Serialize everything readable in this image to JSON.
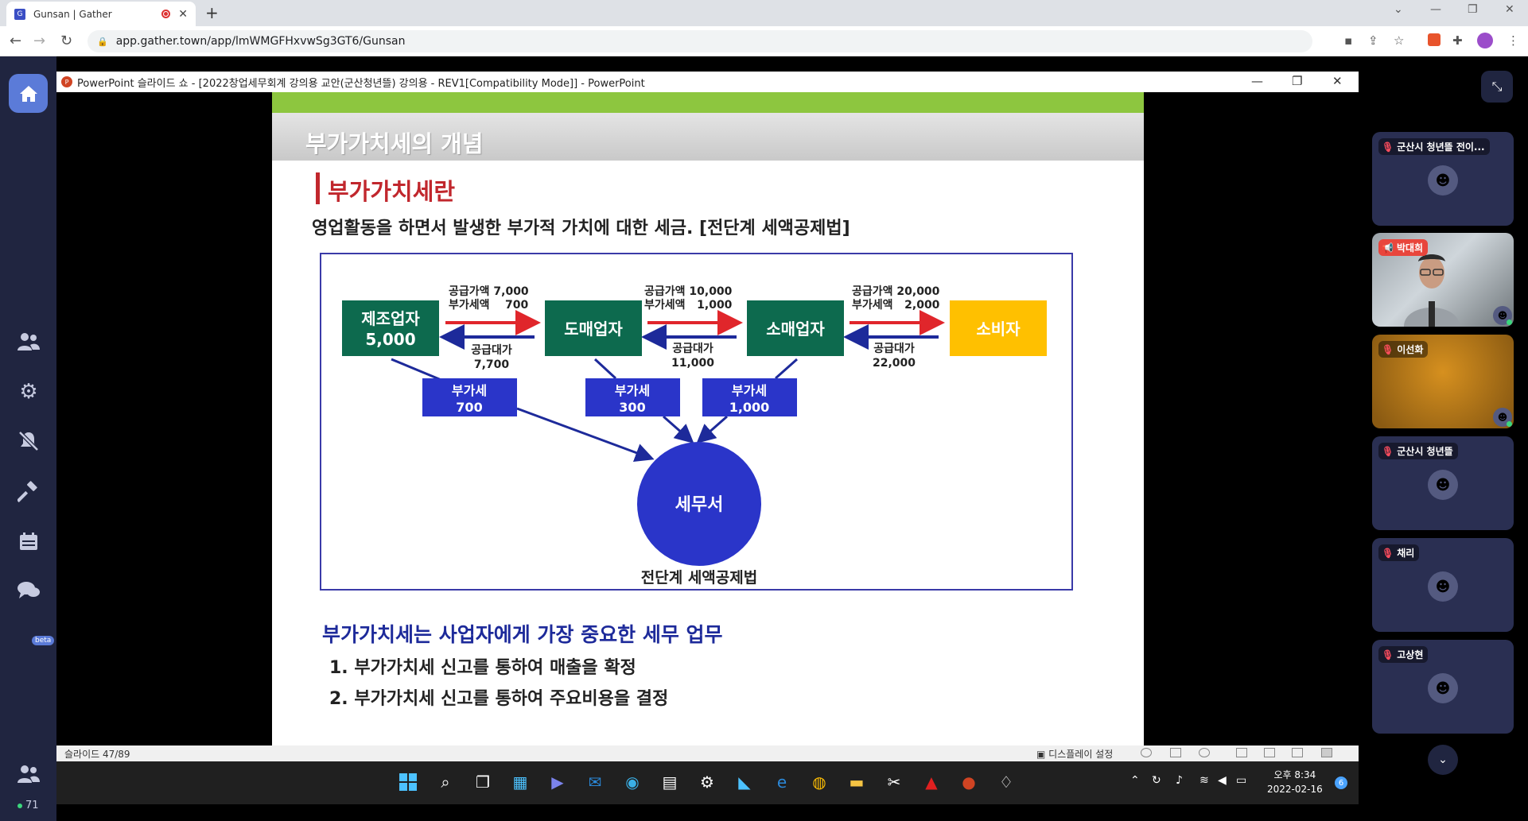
{
  "browser": {
    "tab_title": "Gunsan | Gather",
    "tab_favicon_letter": "G",
    "url": "app.gather.town/app/lmWMGFHxvwSg3GT6/Gunsan"
  },
  "gather": {
    "online_count": "71",
    "beta_label": "beta",
    "participants": [
      {
        "name": "군산시 청년뜰 전이...",
        "muted": true,
        "video": false
      },
      {
        "name": "박대희",
        "muted": false,
        "video": true,
        "presenting": true
      },
      {
        "name": "이선화",
        "muted": true,
        "video": true
      },
      {
        "name": "군산시 청년뜰",
        "muted": true,
        "video": false
      },
      {
        "name": "채리",
        "muted": true,
        "video": false
      },
      {
        "name": "고상현",
        "muted": true,
        "video": false
      }
    ]
  },
  "powerpoint": {
    "window_title": "PowerPoint 슬라이드 쇼 - [2022창업세무회계 강의용 교안(군산청년뜰) 강의용 - REV1[Compatibility Mode]] - PowerPoint",
    "slide_counter": "슬라이드 47/89",
    "display_settings": "디스플레이 설정"
  },
  "slide": {
    "header": "부가가치세의 개념",
    "subtitle": "부가가치세란",
    "description": "영업활동을 하면서 발생한 부가적 가치에 대한 세금. [전단계 세액공제법]",
    "diagram": {
      "entities": [
        {
          "label_line1": "제조업자",
          "label_line2": "5,000",
          "color": "#0d6a4e"
        },
        {
          "label_line1": "도매업자",
          "label_line2": "",
          "color": "#0d6a4e"
        },
        {
          "label_line1": "소매업자",
          "label_line2": "",
          "color": "#0d6a4e"
        },
        {
          "label_line1": "소비자",
          "label_line2": "",
          "color": "#ffc000"
        }
      ],
      "supply_labels": [
        {
          "line1": "공급가액 7,000",
          "line2": "부가세액    700"
        },
        {
          "line1": "공급가액 10,000",
          "line2": "부가세액   1,000"
        },
        {
          "line1": "공급가액 20,000",
          "line2": "부가세액   2,000"
        }
      ],
      "payment_labels": [
        {
          "line1": "공급대가",
          "line2": "7,700"
        },
        {
          "line1": "공급대가",
          "line2": "11,000"
        },
        {
          "line1": "공급대가",
          "line2": "22,000"
        }
      ],
      "vat_boxes": [
        {
          "line1": "부가세",
          "line2": "700"
        },
        {
          "line1": "부가세",
          "line2": "300"
        },
        {
          "line1": "부가세",
          "line2": "1,000"
        }
      ],
      "tax_office": "세무서",
      "caption": "전단계 세액공제법",
      "colors": {
        "supply_arrow": "#e0262b",
        "payment_arrow": "#1d2a9a",
        "vat_box": "#2a35c9",
        "circle": "#2a35c9",
        "frame": "#3a3aa8"
      }
    },
    "importance": "부가가치세는 사업자에게 가장 중요한 세무 업무",
    "points": [
      "1. 부가가치세 신고를 통하여 매출을 확정",
      "2. 부가가치세 신고를 통하여 주요비용을 결정"
    ]
  },
  "taskbar": {
    "time_line1": "오후 8:34",
    "time_line2": "2022-02-16",
    "notification_count": "6"
  }
}
